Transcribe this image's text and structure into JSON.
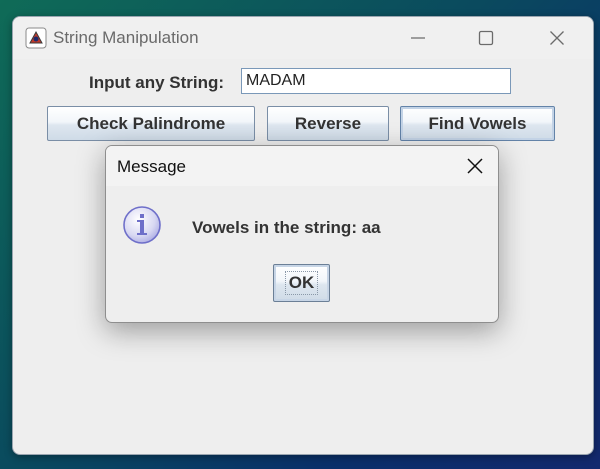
{
  "window": {
    "title": "String Manipulation",
    "controls": {
      "minimize": "minimize-icon",
      "maximize": "maximize-icon",
      "close": "close-icon"
    }
  },
  "form": {
    "input_label": "Input any String:",
    "input_value": "MADAM"
  },
  "buttons": {
    "check_palindrome": "Check Palindrome",
    "reverse": "Reverse",
    "find_vowels": "Find Vowels"
  },
  "dialog": {
    "title": "Message",
    "icon": "info-icon",
    "message": "Vowels in the string: aa",
    "ok_label": "OK"
  },
  "colors": {
    "info_icon": "#6e6fc9",
    "button_border": "#7a8ea6"
  }
}
